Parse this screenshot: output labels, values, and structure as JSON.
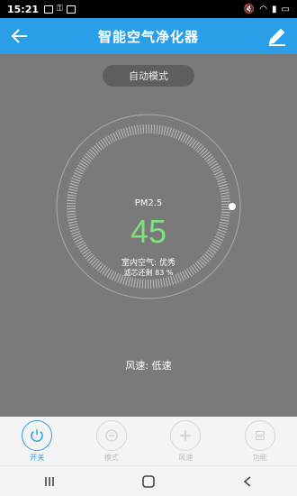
{
  "status_bar": {
    "time": "15:21"
  },
  "app_bar": {
    "title": "智能空气净化器",
    "back_icon": "back-arrow-icon",
    "edit_icon": "pencil-icon"
  },
  "main": {
    "mode_label": "自动模式",
    "pm_label": "PM2.5",
    "pm_value": "45",
    "air_quality": "室内空气: 优秀",
    "filter_remaining": "滤芯还剩 83 %",
    "wind_speed": "风速: 低速"
  },
  "tabs": [
    {
      "label": "开关",
      "icon": "power-icon",
      "active": true
    },
    {
      "label": "模式",
      "icon": "mode-icon",
      "active": false
    },
    {
      "label": "风速",
      "icon": "fan-icon",
      "active": false
    },
    {
      "label": "功能",
      "icon": "function-icon",
      "active": false
    }
  ],
  "colors": {
    "accent": "#2a9fe8",
    "pm_value": "#7fe07f",
    "background": "#7a7a7a"
  }
}
